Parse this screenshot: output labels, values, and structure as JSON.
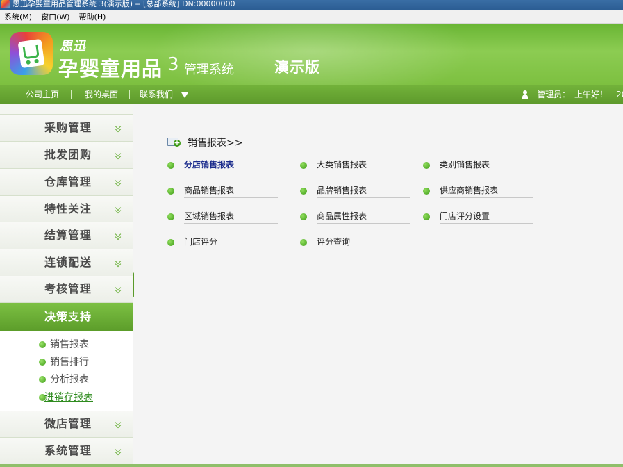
{
  "window": {
    "title": "思迅孕婴童用品管理系统 3(演示版) -- [总部系统] DN:00000000"
  },
  "menubar": {
    "items": [
      "系统(M)",
      "窗口(W)",
      "帮助(H)"
    ]
  },
  "header": {
    "brand_small": "思迅",
    "brand_big": "孕婴童用品",
    "version": "3",
    "system": "管理系统",
    "edition": "演示版"
  },
  "nav": {
    "links": [
      "公司主页",
      "我的桌面",
      "联系我们"
    ],
    "separator": "|",
    "user": "管理员：",
    "greeting": "上午好！",
    "date_fragment": "20"
  },
  "sidebar": {
    "items_top": [
      "采购管理",
      "批发团购",
      "仓库管理",
      "特性关注",
      "结算管理",
      "连锁配送",
      "考核管理"
    ],
    "active": "决策支持",
    "sub_items": [
      "销售报表",
      "销售排行",
      "分析报表",
      "进销存报表"
    ],
    "items_bottom": [
      "微店管理",
      "系统管理"
    ]
  },
  "main": {
    "section_title": "销售报表>>",
    "reports": [
      [
        "分店销售报表",
        "大类销售报表",
        "类别销售报表"
      ],
      [
        "商品销售报表",
        "品牌销售报表",
        "供应商销售报表"
      ],
      [
        "区域销售报表",
        "商品属性报表",
        "门店评分设置"
      ],
      [
        "门店评分",
        "评分查询"
      ]
    ]
  },
  "colors": {
    "brand_green": "#7dc040",
    "nav_green": "#5e9a2c",
    "active_link": "#1a2b8c",
    "sub_link": "#2e8b1e"
  }
}
